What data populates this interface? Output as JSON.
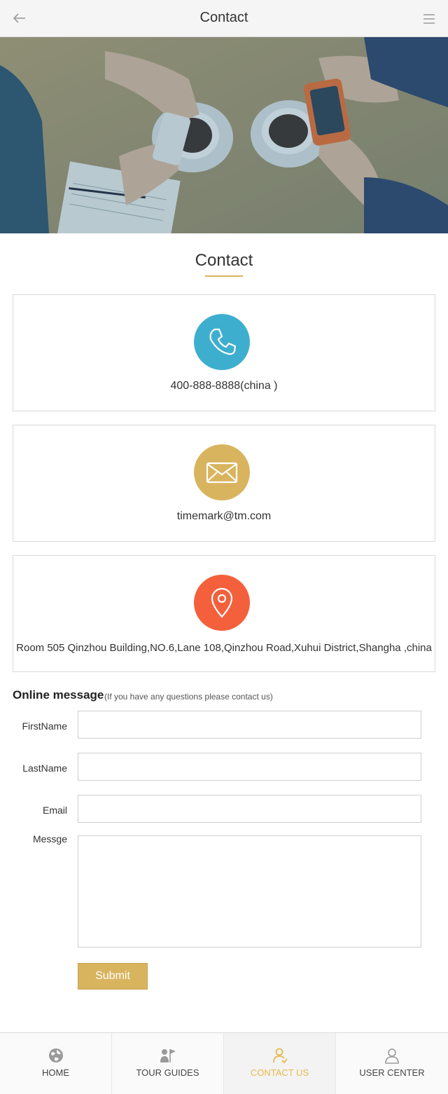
{
  "header": {
    "title": "Contact",
    "back_icon": "arrow-left-icon",
    "menu_icon": "hamburger-menu-icon"
  },
  "hero": {
    "image": "people-with-coffee-and-phones-photo"
  },
  "section": {
    "title": "Contact",
    "accent_color": "#d8b35c"
  },
  "contacts": [
    {
      "icon": "phone-icon",
      "color": "#3eaecf",
      "text": "400-888-8888(china )"
    },
    {
      "icon": "envelope-icon",
      "color": "#d9b45f",
      "text": "timemark@tm.com"
    },
    {
      "icon": "location-pin-icon",
      "color": "#f3603b",
      "text": "Room 505 Qinzhou Building,NO.6,Lane 108,Qinzhou Road,Xuhui District,Shangha ,china"
    }
  ],
  "form": {
    "title": "Online message",
    "subtitle": "(If you have any questions  please contact us)",
    "fields": {
      "firstname_label": "FirstName",
      "firstname_value": "",
      "lastname_label": "LastName",
      "lastname_value": "",
      "email_label": "Email",
      "email_value": "",
      "message_label": "Messge",
      "message_value": ""
    },
    "submit_label": "Submit",
    "submit_color": "#d9b45f"
  },
  "tabbar": {
    "active_color": "#e8b94a",
    "tabs": [
      {
        "label": "HOME",
        "icon": "globe-icon",
        "active": false
      },
      {
        "label": "TOUR GUIDES",
        "icon": "guide-flag-icon",
        "active": false
      },
      {
        "label": "CONTACT US",
        "icon": "contact-person-icon",
        "active": true
      },
      {
        "label": "USER CENTER",
        "icon": "user-icon",
        "active": false
      }
    ]
  }
}
